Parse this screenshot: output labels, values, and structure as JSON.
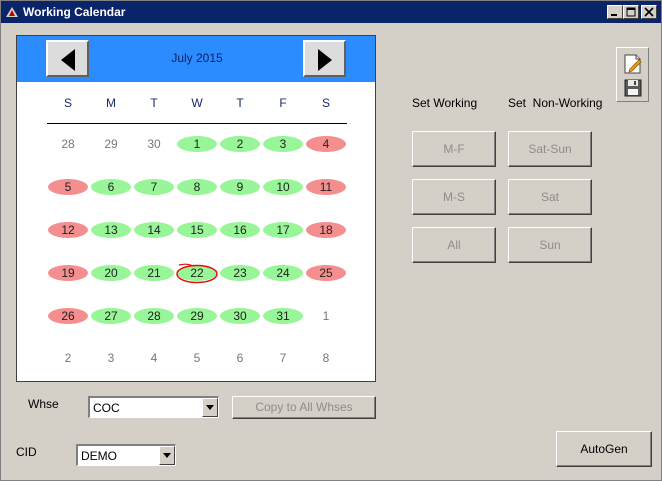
{
  "window": {
    "title": "Working Calendar"
  },
  "calendar": {
    "month_label": "July 2015",
    "weekdays": [
      "S",
      "M",
      "T",
      "W",
      "T",
      "F",
      "S"
    ],
    "weeks": [
      [
        {
          "d": "28",
          "s": "other"
        },
        {
          "d": "29",
          "s": "other"
        },
        {
          "d": "30",
          "s": "other"
        },
        {
          "d": "1",
          "s": "working"
        },
        {
          "d": "2",
          "s": "working"
        },
        {
          "d": "3",
          "s": "working"
        },
        {
          "d": "4",
          "s": "nonworking"
        }
      ],
      [
        {
          "d": "5",
          "s": "nonworking"
        },
        {
          "d": "6",
          "s": "working"
        },
        {
          "d": "7",
          "s": "working"
        },
        {
          "d": "8",
          "s": "working"
        },
        {
          "d": "9",
          "s": "working"
        },
        {
          "d": "10",
          "s": "working"
        },
        {
          "d": "11",
          "s": "nonworking"
        }
      ],
      [
        {
          "d": "12",
          "s": "nonworking"
        },
        {
          "d": "13",
          "s": "working"
        },
        {
          "d": "14",
          "s": "working"
        },
        {
          "d": "15",
          "s": "working"
        },
        {
          "d": "16",
          "s": "working"
        },
        {
          "d": "17",
          "s": "working"
        },
        {
          "d": "18",
          "s": "nonworking"
        }
      ],
      [
        {
          "d": "19",
          "s": "nonworking"
        },
        {
          "d": "20",
          "s": "working"
        },
        {
          "d": "21",
          "s": "working"
        },
        {
          "d": "22",
          "s": "working",
          "today": true
        },
        {
          "d": "23",
          "s": "working"
        },
        {
          "d": "24",
          "s": "working"
        },
        {
          "d": "25",
          "s": "nonworking"
        }
      ],
      [
        {
          "d": "26",
          "s": "nonworking"
        },
        {
          "d": "27",
          "s": "working"
        },
        {
          "d": "28",
          "s": "working"
        },
        {
          "d": "29",
          "s": "working"
        },
        {
          "d": "30",
          "s": "working"
        },
        {
          "d": "31",
          "s": "working"
        },
        {
          "d": "1",
          "s": "other"
        }
      ],
      [
        {
          "d": "2",
          "s": "other"
        },
        {
          "d": "3",
          "s": "other"
        },
        {
          "d": "4",
          "s": "other"
        },
        {
          "d": "5",
          "s": "other"
        },
        {
          "d": "6",
          "s": "other"
        },
        {
          "d": "7",
          "s": "other"
        },
        {
          "d": "8",
          "s": "other"
        }
      ]
    ],
    "colors": {
      "working": "#98f598",
      "nonworking": "#f58e8e",
      "header": "#2b8cff",
      "today_ring": "#e01010"
    }
  },
  "panel": {
    "set_working_label": "Set Working",
    "set_nonworking_label": "Set  Non-Working",
    "working_buttons": [
      "M-F",
      "M-S",
      "All"
    ],
    "nonworking_buttons": [
      "Sat-Sun",
      "Sat",
      "Sun"
    ]
  },
  "whse": {
    "label": "Whse",
    "value": "COC",
    "copy_label": "Copy to All Whses"
  },
  "cid": {
    "label": "CID",
    "value": "DEMO"
  },
  "autogen_label": "AutoGen",
  "icons": {
    "edit": "edit-page-icon",
    "save": "floppy-save-icon"
  }
}
